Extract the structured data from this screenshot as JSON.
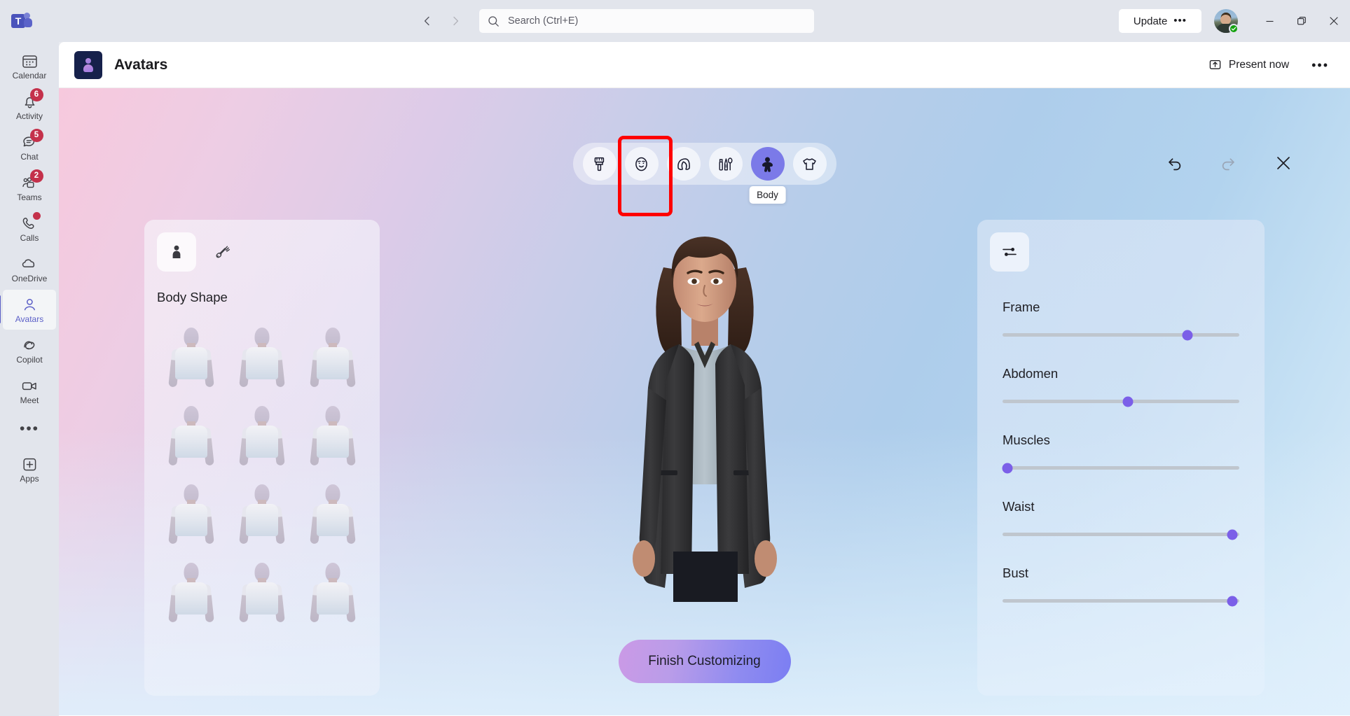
{
  "titlebar": {
    "logo_text": "T",
    "back_icon": "chevron-left-icon",
    "forward_icon": "chevron-right-icon",
    "search_placeholder": "Search (Ctrl+E)",
    "search_value": "",
    "update_label": "Update",
    "update_dots": "•••",
    "minimize_label": "Minimize",
    "maximize_label": "Restore",
    "close_label": "Close"
  },
  "rail": {
    "items": [
      {
        "label": "Calendar",
        "icon": "calendar-icon",
        "badge": "",
        "active": false
      },
      {
        "label": "Activity",
        "icon": "bell-icon",
        "badge": "6",
        "active": false
      },
      {
        "label": "Chat",
        "icon": "chat-icon",
        "badge": "5",
        "active": false
      },
      {
        "label": "Teams",
        "icon": "teams-icon",
        "badge": "2",
        "active": false
      },
      {
        "label": "Calls",
        "icon": "phone-icon",
        "badge": "dot",
        "active": false
      },
      {
        "label": "OneDrive",
        "icon": "cloud-icon",
        "badge": "",
        "active": false
      },
      {
        "label": "Avatars",
        "icon": "person-icon",
        "badge": "",
        "active": true
      },
      {
        "label": "Copilot",
        "icon": "copilot-icon",
        "badge": "",
        "active": false
      },
      {
        "label": "Meet",
        "icon": "video-camera-icon",
        "badge": "",
        "active": false
      }
    ],
    "more_label": "•••",
    "apps_label": "Apps"
  },
  "app_header": {
    "title": "Avatars",
    "app_icon": "avatars-app-icon",
    "present_label": "Present now",
    "present_icon": "share-screen-icon",
    "more_dots": "•••"
  },
  "category_bar": {
    "items": [
      {
        "name": "style",
        "icon": "paintbrush-icon",
        "selected": false
      },
      {
        "name": "face",
        "icon": "face-icon",
        "selected": false
      },
      {
        "name": "hair",
        "icon": "hair-icon",
        "selected": false
      },
      {
        "name": "makeup",
        "icon": "makeup-icon",
        "selected": false
      },
      {
        "name": "body",
        "icon": "body-icon",
        "selected": true
      },
      {
        "name": "clothing",
        "icon": "tshirt-icon",
        "selected": false
      }
    ],
    "selected_tooltip": "Body",
    "highlight_color": "#ff0000"
  },
  "stage_actions": {
    "undo": "undo-icon",
    "redo": "redo-icon",
    "close": "close-icon",
    "redo_disabled": true
  },
  "left_panel": {
    "tabs": [
      {
        "name": "body-shape",
        "icon": "person-solid-icon",
        "active": true
      },
      {
        "name": "prosthetics",
        "icon": "prosthetic-arm-icon",
        "active": false
      }
    ],
    "section_title": "Body Shape",
    "shape_count": 12
  },
  "right_panel": {
    "tab_icon": "sliders-icon",
    "sliders": [
      {
        "label": "Frame",
        "value": 78
      },
      {
        "label": "Abdomen",
        "value": 53
      },
      {
        "label": "Muscles",
        "value": 2
      },
      {
        "label": "Waist",
        "value": 97
      },
      {
        "label": "Bust",
        "value": 97
      }
    ],
    "thumb_color": "#7b5fe8",
    "track_color": "#bfc6ce"
  },
  "finish_button": {
    "label": "Finish Customizing"
  }
}
